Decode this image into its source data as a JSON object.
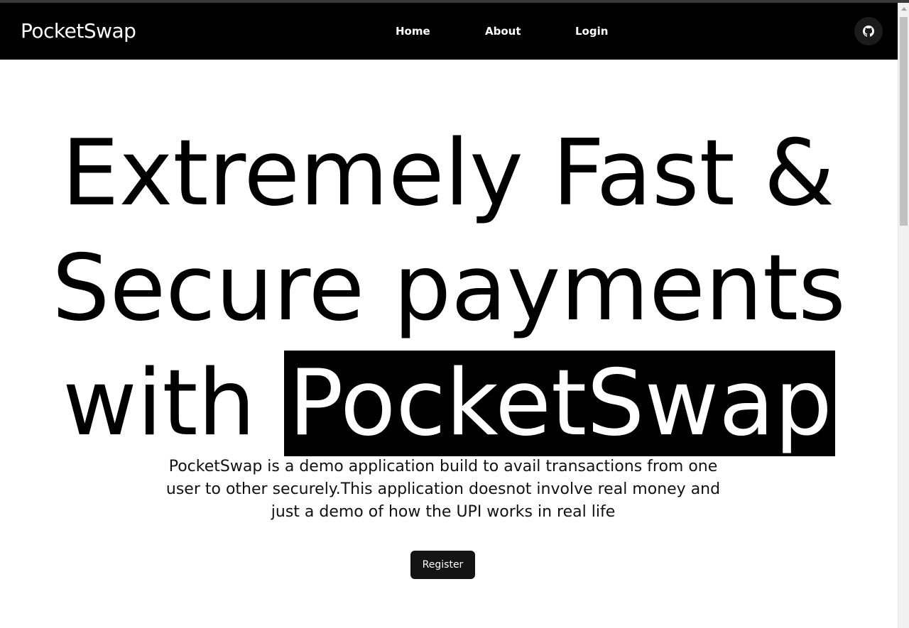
{
  "navbar": {
    "brand": "PocketSwap",
    "links": [
      {
        "label": "Home"
      },
      {
        "label": "About"
      },
      {
        "label": "Login"
      }
    ],
    "github_icon": "github-icon"
  },
  "hero": {
    "headline_line1": "Extremely Fast &",
    "headline_line2": "Secure payments",
    "headline_line3_prefix": "with",
    "headline_highlight": "PocketSwap",
    "description": "PocketSwap is a demo application build to avail transactions from one user to other securely.This application doesnot involve real money and just a demo of how the UPI works in real life",
    "register_label": "Register"
  },
  "colors": {
    "navbar_bg": "#000000",
    "highlight_bg": "#000000",
    "button_bg": "#141414",
    "page_bg": "#ffffff"
  }
}
